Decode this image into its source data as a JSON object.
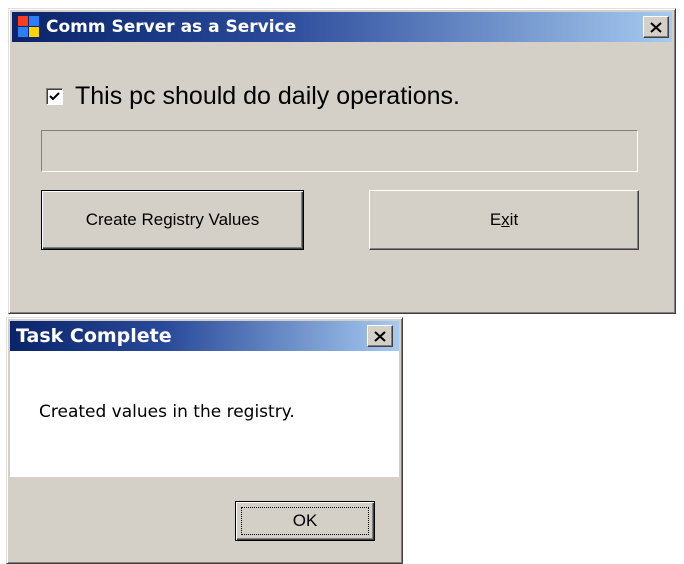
{
  "main_window": {
    "title": "Comm Server as a Service",
    "close_glyph": "✕",
    "icon": "app-window-icon",
    "checkbox": {
      "label": "This pc should do daily operations.",
      "checked": true
    },
    "progress": {
      "value": 0
    },
    "buttons": {
      "create_label": "Create Registry Values",
      "exit_label_prefix": "E",
      "exit_label_mnemonic": "x",
      "exit_label_suffix": "it"
    }
  },
  "message_box": {
    "title": "Task Complete",
    "close_glyph": "✕",
    "message": "Created values in the registry.",
    "ok_label": "OK"
  },
  "colors": {
    "title_active_start": "#0a246a",
    "title_active_end": "#a6caf0",
    "face": "#d4d0c8"
  }
}
